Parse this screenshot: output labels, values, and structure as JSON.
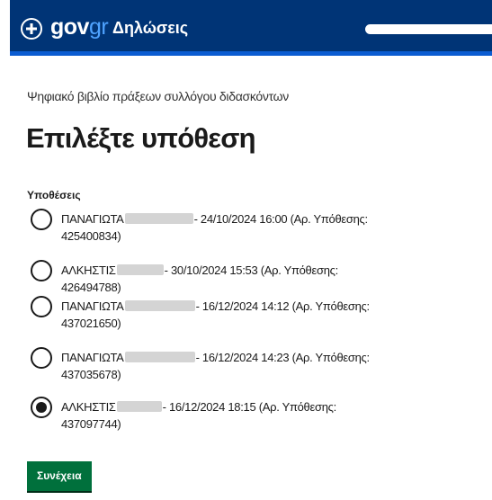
{
  "header": {
    "logo_part1": "gov",
    "logo_part2": "gr",
    "title": "Δηλώσεις"
  },
  "main": {
    "subtitle": "Ψηφιακό βιβλίο πράξεων συλλόγου διδασκόντων",
    "title": "Επιλέξτε υπόθεση",
    "legend": "Υποθέσεις",
    "options": [
      {
        "name": "ΠΑΝΑΓΙΩΤΑ",
        "detail": "- 24/10/2024 16:00 (Αρ. Υπόθεσης: 425400834)",
        "checked": false
      },
      {
        "name": "ΑΛΚΗΣΤΙΣ",
        "detail": "- 30/10/2024 15:53 (Αρ. Υπόθεσης: 426494788)",
        "checked": false
      },
      {
        "name": "ΠΑΝΑΓΙΩΤΑ",
        "detail": "- 16/12/2024 14:12 (Αρ. Υπόθεσης: 437021650)",
        "checked": false
      },
      {
        "name": "ΠΑΝΑΓΙΩΤΑ",
        "detail": "- 16/12/2024 14:23 (Αρ. Υπόθεσης: 437035678)",
        "checked": false
      },
      {
        "name": "ΑΛΚΗΣΤΙΣ",
        "detail": "- 16/12/2024 18:15 (Αρ. Υπόθεσης: 437097744)",
        "checked": true
      }
    ],
    "continue_label": "Συνέχεια"
  }
}
